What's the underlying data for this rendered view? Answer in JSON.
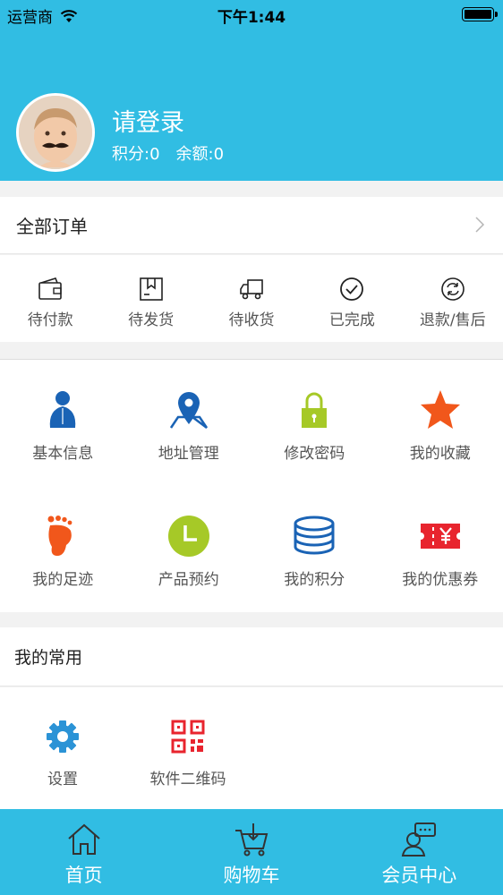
{
  "status_bar": {
    "carrier": "运营商",
    "time": "下午1:44"
  },
  "profile": {
    "login_text": "请登录",
    "points_label": "积分:0",
    "balance_label": "余额:0"
  },
  "orders": {
    "all_label": "全部订单",
    "statuses": [
      {
        "label": "待付款",
        "icon": "wallet-icon"
      },
      {
        "label": "待发货",
        "icon": "package-icon"
      },
      {
        "label": "待收货",
        "icon": "truck-icon"
      },
      {
        "label": "已完成",
        "icon": "check-circle-icon"
      },
      {
        "label": "退款/售后",
        "icon": "refund-icon"
      }
    ]
  },
  "features": [
    {
      "label": "基本信息",
      "icon": "user-icon",
      "color": "#1a63b5"
    },
    {
      "label": "地址管理",
      "icon": "location-pin-icon",
      "color": "#1a63b5"
    },
    {
      "label": "修改密码",
      "icon": "lock-icon",
      "color": "#a6c927"
    },
    {
      "label": "我的收藏",
      "icon": "star-icon",
      "color": "#f1571b"
    },
    {
      "label": "我的足迹",
      "icon": "footprint-icon",
      "color": "#f1571b"
    },
    {
      "label": "产品预约",
      "icon": "clock-icon",
      "color": "#a6c927"
    },
    {
      "label": "我的积分",
      "icon": "coin-stack-icon",
      "color": "#1a63b5"
    },
    {
      "label": "我的优惠券",
      "icon": "coupon-icon",
      "color": "#e8242e"
    }
  ],
  "common": {
    "title": "我的常用",
    "items": [
      {
        "label": "设置",
        "icon": "gear-icon",
        "color": "#2b93d6"
      },
      {
        "label": "软件二维码",
        "icon": "qr-code-icon",
        "color": "#e8242e"
      }
    ]
  },
  "tabbar": {
    "tabs": [
      {
        "label": "首页",
        "icon": "home-icon"
      },
      {
        "label": "购物车",
        "icon": "cart-icon"
      },
      {
        "label": "会员中心",
        "icon": "member-icon"
      }
    ]
  },
  "colors": {
    "brand": "#31bde3"
  }
}
